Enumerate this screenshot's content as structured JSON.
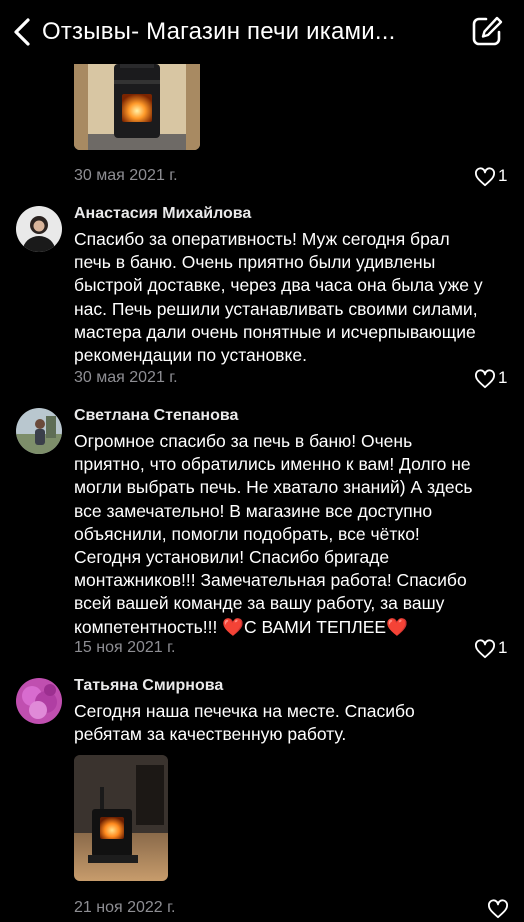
{
  "header": {
    "title": "Отзывы- Магазин печи иками...",
    "back_icon": "chevron-left-icon",
    "edit_icon": "compose-icon"
  },
  "top_item": {
    "date": "30 мая 2021 г.",
    "likes": "1"
  },
  "reviews": [
    {
      "name": "Анастасия Михайлова",
      "lines": [
        "Спасибо за оперативность! Муж сегодня брал",
        "печь в баню. Очень приятно были удивлены",
        "быстрой доставке, через два часа она была уже у",
        "нас. Печь решили устанавливать своими силами,",
        "мастера дали очень понятные и исчерпывающие",
        "рекомендации по установке."
      ],
      "date": "30 мая 2021 г.",
      "likes": "1"
    },
    {
      "name": "Светлана Степанова",
      "lines": [
        "Огромное спасибо за печь в баню! Очень",
        "приятно, что обратились именно к вам! Долго не",
        "могли выбрать печь. Не хватало знаний) А здесь",
        "все замечательно! В магазине все доступно",
        "объяснили, помогли подобрать, все чётко!",
        "Сегодня установили! Спасибо бригаде",
        "монтажников!!! Замечательная работа! Спасибо",
        "всей вашей команде за вашу работу, за вашу",
        "компетентность!!! ❤️С ВАМИ ТЕПЛЕЕ❤️"
      ],
      "date": "15 ноя 2021 г.",
      "likes": "1"
    },
    {
      "name": "Татьяна Смирнова",
      "lines": [
        "Сегодня наша печечка на месте. Спасибо",
        "ребятам за качественную работу."
      ],
      "date": "21 ноя 2022 г.",
      "likes": ""
    }
  ]
}
